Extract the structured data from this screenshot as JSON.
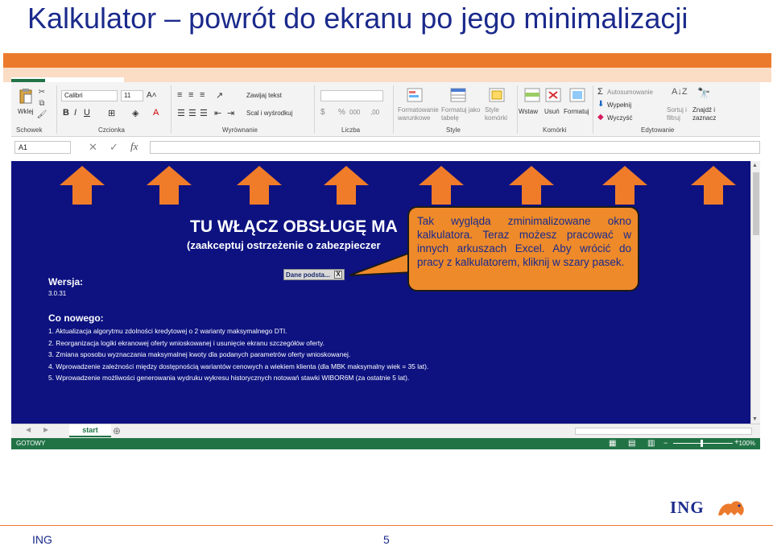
{
  "slide": {
    "title": "Kalkulator – powrót do ekranu po jego minimalizacji",
    "footer_left": "ING",
    "page_number": "5",
    "logo_text": "ING"
  },
  "ribbon": {
    "paste_label": "Wklej",
    "font_name": "Calibri",
    "font_size": "11",
    "wrap_text": "Zawijaj tekst",
    "merge_center": "Scal i wyśrodkuj",
    "conditional_formatting": "Formatowanie warunkowe",
    "format_as_table": "Formatuj jako tabelę",
    "cell_styles": "Style komórki",
    "insert": "Wstaw",
    "delete": "Usuń",
    "format": "Formatuj",
    "autosum": "Autosumowanie",
    "fill": "Wypełnij",
    "clear": "Wyczyść",
    "sort_filter": "Sortuj i filtruj",
    "find_select": "Znajdź i zaznacz",
    "groups": {
      "clipboard": "Schowek",
      "font": "Czcionka",
      "alignment": "Wyrównanie",
      "number": "Liczba",
      "styles": "Style",
      "cells": "Komórki",
      "editing": "Edytowanie"
    }
  },
  "formula_bar": {
    "name_box": "A1",
    "fx_label": "fx",
    "value": ""
  },
  "sheet": {
    "heading": "TU WŁĄCZ OBSŁUGĘ MA",
    "subheading": "(zaakceptuj ostrzeżenie o zabezpieczer",
    "version_label": "Wersja:",
    "version_value": "3.0.31",
    "minimized_window_title": "Dane podsta...",
    "minimized_window_close": "X",
    "whats_new_label": "Co nowego:",
    "changes": [
      "1. Aktualizacja algorytmu zdolności kredytowej o 2 warianty maksymalnego DTI.",
      "2. Reorganizacja logiki ekranowej oferty wnioskowanej i usunięcie ekranu szczegółów oferty.",
      "3. Zmiana sposobu wyznaczania maksymalnej kwoty dla podanych parametrów oferty wnioskowanej.",
      "4. Wprowadzenie zależności między dostępnością wariantów cenowych a wiekiem klienta (dla MBK maksymalny wiek = 35 lat).",
      "5. Wprowadzenie możliwości generowania wydruku wykresu historycznych notowań stawki WIBOR6M (za ostatnie 5 lat)."
    ]
  },
  "callout": {
    "text": "Tak wygląda zminimalizowane okno kalkulatora. Teraz możesz pracować w innych arkuszach Excel. Aby wrócić do pracy z kalkulatorem, kliknij w szary pasek."
  },
  "sheet_tabs": {
    "active_tab": "start",
    "add_sheet": "⊕"
  },
  "status_bar": {
    "status": "GOTOWY",
    "zoom": "100%"
  },
  "colors": {
    "accent_orange": "#ec7a2d",
    "sheet_bg": "#0d1280",
    "ing_blue": "#1b2a8c",
    "excel_green": "#217346"
  }
}
